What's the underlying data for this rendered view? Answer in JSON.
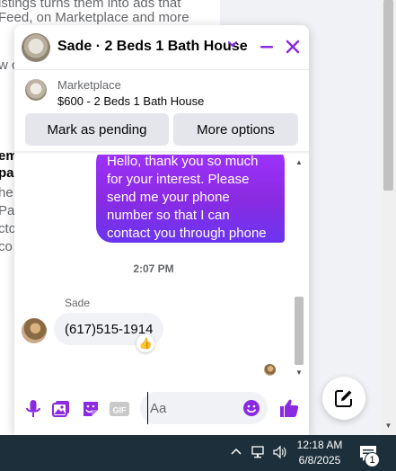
{
  "background": {
    "snippets": [
      "istings turns them into ads that",
      "Feed, on Marketplace and more",
      "w c",
      "em",
      "pa",
      "he",
      "Pa",
      "cto",
      "co"
    ]
  },
  "chat": {
    "title": "Sade · 2 Beds 1 Bath House",
    "listing": {
      "source": "Marketplace",
      "title": "$600 - 2 Beds 1 Bath House"
    },
    "buttons": {
      "mark_pending": "Mark as pending",
      "more_options": "More options"
    },
    "messages": {
      "sent_lines": [
        "Hello, thank you so much",
        "for your interest. Please",
        "send me your phone",
        "number so that I can",
        "contact you through phone"
      ],
      "timestamp": "2:07 PM",
      "sender_name": "Sade",
      "received_text": "(617)515-1914",
      "reaction": "👍"
    },
    "composer": {
      "placeholder": "Aa"
    },
    "colors": {
      "accent": "#8a2be2",
      "bubble_gradient_top": "#a033ff",
      "bubble_gradient_bottom": "#6a35f0",
      "like": "#1877f2"
    }
  },
  "taskbar": {
    "time": "12:18 AM",
    "date": "6/8/2025",
    "notification_count": "1"
  },
  "icons": {
    "header": [
      "chevron-down-icon",
      "minimize-icon",
      "close-icon"
    ],
    "composer": [
      "microphone-icon",
      "photo-icon",
      "sticker-icon",
      "gif-icon",
      "emoji-icon",
      "thumbs-up-icon"
    ],
    "floating": "compose-new-message-icon",
    "tray": [
      "chevron-up-icon",
      "network-icon",
      "volume-icon",
      "notification-icon"
    ]
  }
}
